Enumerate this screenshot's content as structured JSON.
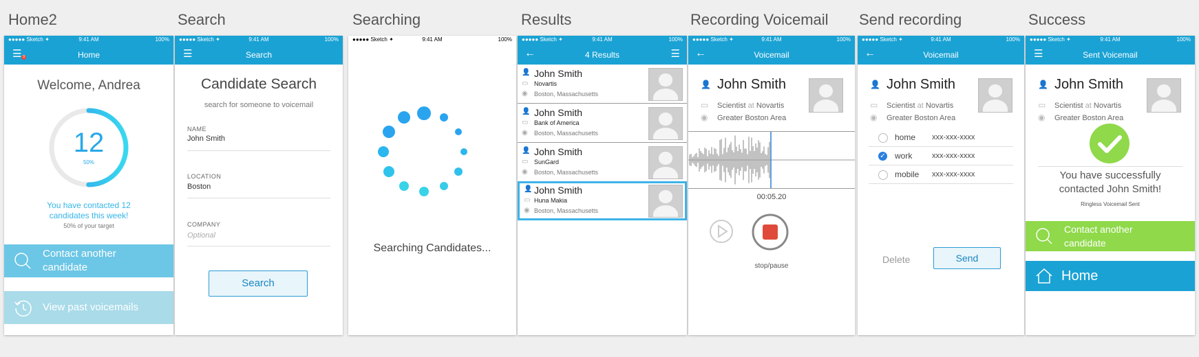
{
  "screens": {
    "home": {
      "label": "Home2",
      "status": {
        "carrier": "●●●●● Sketch ✦",
        "time": "9:41 AM",
        "battery": "100%"
      },
      "nav_title": "Home",
      "badge": "3",
      "welcome": "Welcome, Andrea",
      "count": "12",
      "count_pct": "50%",
      "progress_fraction": 0.5,
      "contacted_line1": "You have contacted 12",
      "contacted_line2": "candidates this week!",
      "target": "50% of your target",
      "btn_contact": "Contact another candidate",
      "btn_past": "View past voicemails"
    },
    "search": {
      "label": "Search",
      "status": {
        "carrier": "●●●●● Sketch ✦",
        "time": "9:41 AM",
        "battery": "100%"
      },
      "nav_title": "Search",
      "heading": "Candidate Search",
      "subheading": "search for someone to voicemail",
      "name_label": "NAME",
      "name_value": "John Smith",
      "location_label": "LOCATION",
      "location_value": "Boston",
      "company_label": "COMPANY",
      "company_placeholder": "Optional",
      "button": "Search"
    },
    "searching": {
      "label": "Searching",
      "status": {
        "carrier": "●●●●● Sketch ✦",
        "time": "9:41 AM",
        "battery": "100%"
      },
      "text": "Searching Candidates..."
    },
    "results": {
      "label": "Results",
      "status": {
        "carrier": "●●●●● Sketch ✦",
        "time": "9:41 AM",
        "battery": "100%"
      },
      "nav_title": "4 Results",
      "items": [
        {
          "name": "John Smith",
          "org": "Novartis",
          "loc": "Boston, Massachusetts"
        },
        {
          "name": "John Smith",
          "org": "Bank of America",
          "loc": "Boston, Massachusetts"
        },
        {
          "name": "John Smith",
          "org": "SunGard",
          "loc": "Boston, Massachusetts"
        },
        {
          "name": "John Smith",
          "org": "Huna Makia",
          "loc": "Boston, Massachusetts"
        }
      ]
    },
    "recording": {
      "label": "Recording Voicemail",
      "status": {
        "carrier": "●●●●● Sketch ✦",
        "time": "9:41 AM",
        "battery": "100%"
      },
      "nav_title": "Voicemail",
      "name": "John Smith",
      "title": "Scientist",
      "at": "at",
      "company": "Novartis",
      "area": "Greater Boston Area",
      "time": "00:05.20",
      "stop_label": "stop/pause"
    },
    "send": {
      "label": "Send recording",
      "status": {
        "carrier": "●●●●● Sketch ✦",
        "time": "9:41 AM",
        "battery": "100%"
      },
      "nav_title": "Voicemail",
      "name": "John Smith",
      "title": "Scientist",
      "at": "at",
      "company": "Novartis",
      "area": "Greater Boston Area",
      "phones": [
        {
          "type": "home",
          "number": "xxx-xxx-xxxx",
          "checked": false
        },
        {
          "type": "work",
          "number": "xxx-xxx-xxxx",
          "checked": true
        },
        {
          "type": "mobile",
          "number": "xxx-xxx-xxxx",
          "checked": false
        }
      ],
      "delete": "Delete",
      "send": "Send"
    },
    "success": {
      "label": "Success",
      "status": {
        "carrier": "●●●●● Sketch ✦",
        "time": "9:41 AM",
        "battery": "100%"
      },
      "nav_title": "Sent Voicemail",
      "name": "John Smith",
      "title": "Scientist",
      "at": "at",
      "company": "Novartis",
      "area": "Greater Boston Area",
      "msg1": "You have successfully",
      "msg2": "contacted John Smith!",
      "sub": "Ringless Voicemail Sent",
      "btn_contact": "Contact another candidate",
      "btn_home": "Home"
    }
  },
  "colors": {
    "nav": "#1aa2d4",
    "accent": "#29b6f6",
    "green": "#8fd94a",
    "record": "#e04a3a"
  }
}
